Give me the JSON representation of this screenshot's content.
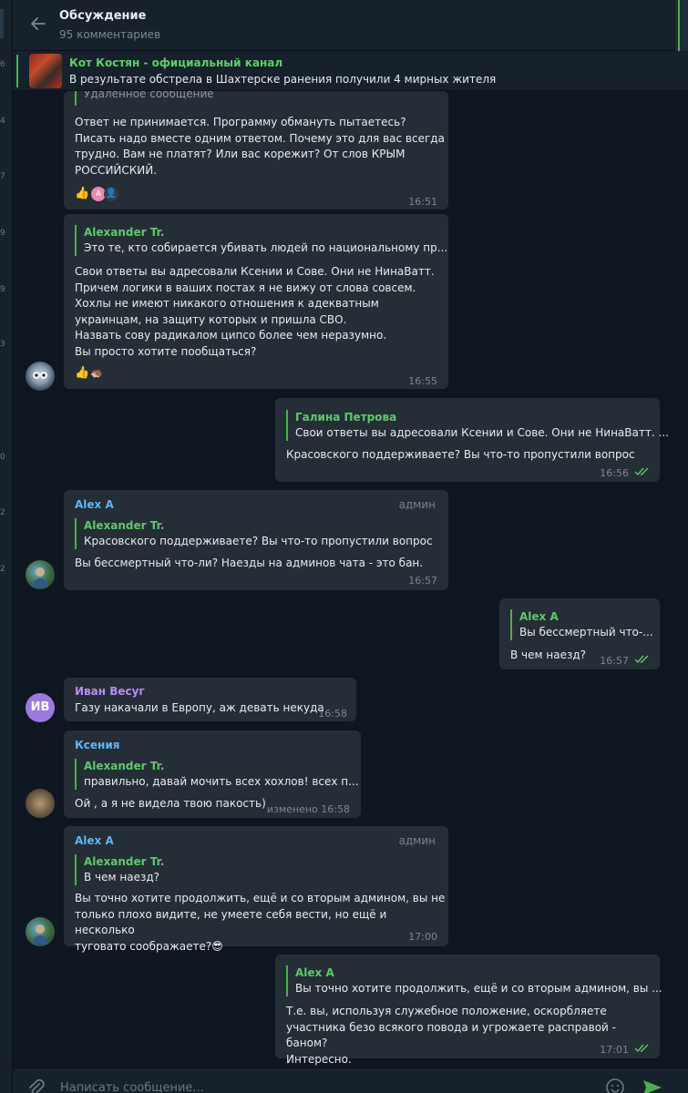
{
  "header": {
    "title": "Обсуждение",
    "subtitle": "95 комментариев"
  },
  "pinned": {
    "title": "Кот Костян - официальный канал",
    "text": "В результате обстрела в Шахтерске ранения получили 4 мирных жителя"
  },
  "left_marks": [
    "6",
    "4",
    "7",
    "9",
    "9",
    "3",
    "0",
    "2",
    "2"
  ],
  "messages": [
    {
      "quote_name": "",
      "quote_text": "Удаленное сообщение",
      "body": "Ответ не принимается. Программу обмануть пытаетесь?\nПисать надо вместе одним ответом. Почему это для вас всегда\nтрудно. Вам не платят? Или вас корежит? От слов КРЫМ\nРОССИЙСКИЙ.",
      "reactions": [
        "👍",
        "A",
        "👤"
      ],
      "time": "16:51"
    },
    {
      "quote_name": "Alexander Tr.",
      "quote_text": "Это те, кто собирается убивать людей по национальному пр...",
      "body": "Свои ответы вы адресовали Ксении и Сове. Они не НинаВатт.\nПричем логики в ваших постах я не вижу от слова совсем.\nХохлы не имеют никакого отношения к адекватным\nукраинцам, на защиту которых и пришла СВО.\nНазвать сову радикалом ципсо более чем неразумно.\nВы просто хотите пообщаться?",
      "reactions": [
        "👍",
        "🦔"
      ],
      "time": "16:55"
    },
    {
      "quote_name": "Галина Петрова",
      "quote_text": "Свои ответы вы адресовали Ксении и Сове. Они не НинаВатт. ...",
      "body": "Красовского поддерживаете? Вы что-то пропустили вопрос",
      "time": "16:56"
    },
    {
      "sender": "Alex A",
      "admin": "админ",
      "quote_name": "Alexander Tr.",
      "quote_text": "Красовского поддерживаете? Вы что-то пропустили вопрос",
      "body": "Вы бессмертный что-ли? Наезды на админов чата - это бан.",
      "time": "16:57"
    },
    {
      "quote_name": "Alex A",
      "quote_text": "Вы бессмертный что-...",
      "body": "В чем наезд?",
      "time": "16:57"
    },
    {
      "sender": "Иван Весуг",
      "avatar_initials": "ИВ",
      "body": "Газу накачали в Европу, аж девать некуда",
      "time": "16:58"
    },
    {
      "sender": "Ксения",
      "quote_name": "Alexander Tr.",
      "quote_text": "правильно, давай мочить всех хохлов! всех п...",
      "body": "Ой , а я не видела твою пакость)",
      "time": "изменено 16:58"
    },
    {
      "sender": "Alex A",
      "admin": "админ",
      "quote_name": "Alexander Tr.",
      "quote_text": "В чем наезд?",
      "body": "Вы точно хотите продолжить, ещё и со вторым админом, вы не\nтолько плохо видите, не умеете себя вести, но ещё и несколько\nтуговато соображаете?😎",
      "time": "17:00"
    },
    {
      "quote_name": "Alex A",
      "quote_text": "Вы точно хотите продолжить, ещё и со вторым админом, вы ...",
      "body": "Т.е. вы, используя служебное положение, оскорбляете\nучастника безо всякого повода и угрожаете расправой - баном?\nИнтересно.",
      "time": "17:01"
    }
  ],
  "input": {
    "placeholder": "Написать сообщение..."
  },
  "colors": {
    "background": "#0e1621",
    "panel": "#17212b",
    "bubble": "#252d36",
    "accent_green": "#4fae4e",
    "name_blue": "#5eb5f7",
    "name_purple": "#b88cf4"
  }
}
